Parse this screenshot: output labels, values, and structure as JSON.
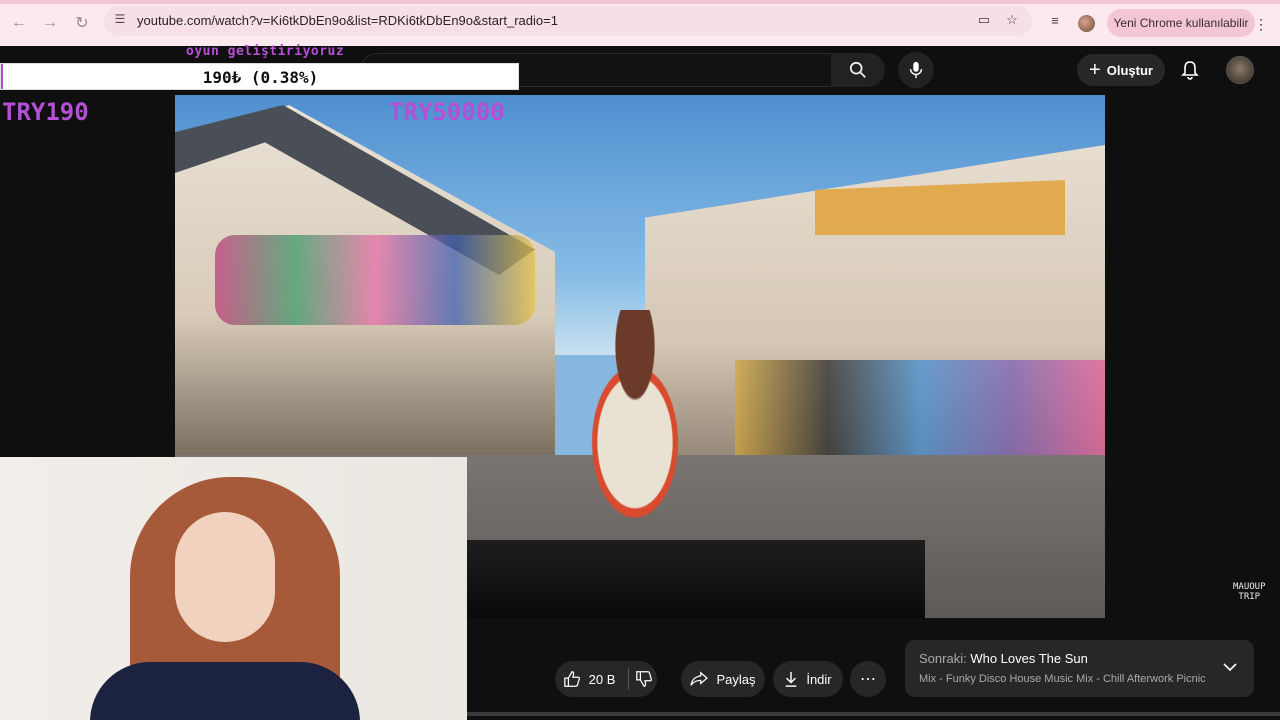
{
  "browser": {
    "url": "youtube.com/watch?v=Ki6tkDbEn9o&list=RDKi6tkDbEn9o&start_radio=1",
    "update_chip": "Yeni Chrome kullanılabilir",
    "icons": [
      "back-icon",
      "forward-icon",
      "reload-icon",
      "site-info-icon",
      "install-icon",
      "bookmark-star-icon",
      "reading-list-icon",
      "profile-avatar",
      "menu-icon"
    ]
  },
  "youtube_header": {
    "create_label": "Oluştur",
    "icons": [
      "search-icon",
      "mic-icon",
      "bell-icon"
    ]
  },
  "overlay": {
    "caption": "oyun geliştiriyoruz",
    "donation_amount": "190₺ (0.38%)",
    "donation_progress_percent": 0.38,
    "goal_current": "TRY190",
    "goal_target": "TRY50000",
    "accent_color": "#b44fd6"
  },
  "video": {
    "watermark_line1": "MAUOUP",
    "watermark_line2": "TRIP"
  },
  "actions": {
    "like_count": "20 B",
    "share_label": "Paylaş",
    "download_label": "İndir"
  },
  "next_up": {
    "label": "Sonraki:",
    "title": "Who Loves The Sun",
    "subtitle": "Mix - Funky Disco House Music Mix - Chill Afterwork Picnic"
  }
}
